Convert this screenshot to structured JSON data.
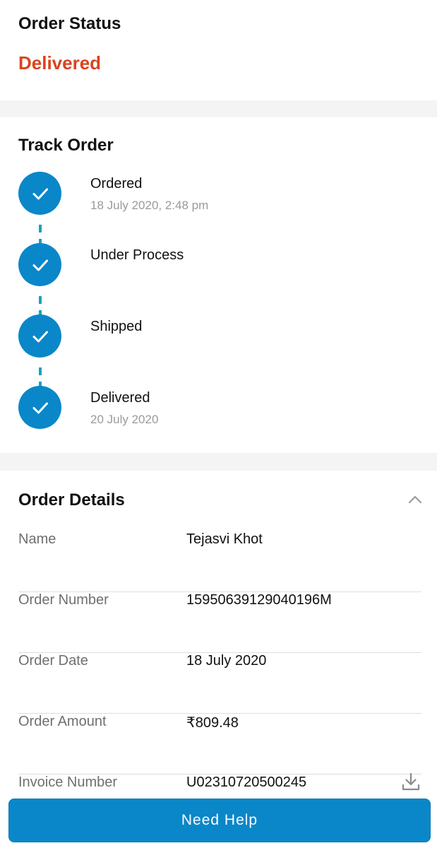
{
  "order_status": {
    "title": "Order Status",
    "value": "Delivered",
    "value_color": "#d9441f"
  },
  "track_order": {
    "title": "Track Order",
    "accent_color": "#0a87c9",
    "steps": [
      {
        "label": "Ordered",
        "date": "18 July 2020, 2:48 pm",
        "completed": true,
        "icon": "check-icon"
      },
      {
        "label": "Under Process",
        "date": "",
        "completed": true,
        "icon": "check-icon"
      },
      {
        "label": "Shipped",
        "date": "",
        "completed": true,
        "icon": "check-icon"
      },
      {
        "label": "Delivered",
        "date": "20 July 2020",
        "completed": true,
        "icon": "check-icon"
      }
    ]
  },
  "order_details": {
    "title": "Order Details",
    "toggle_icon": "chevron-up-icon",
    "rows": [
      {
        "key": "Name",
        "value": "Tejasvi Khot"
      },
      {
        "key": "Order Number",
        "value": "15950639129040196M"
      },
      {
        "key": "Order Date",
        "value": "18 July 2020"
      },
      {
        "key": "Order Amount",
        "value": "₹809.48"
      },
      {
        "key": "Invoice Number",
        "value": "U02310720500245",
        "icon": "download-icon"
      }
    ]
  },
  "footer": {
    "help_label": "Need Help",
    "button_color": "#0a87c9"
  }
}
